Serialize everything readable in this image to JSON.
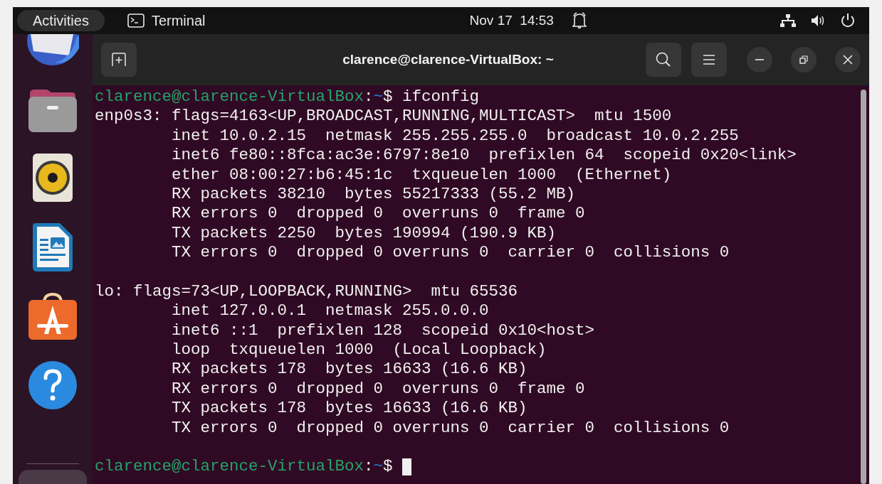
{
  "top_bar": {
    "activities": "Activities",
    "app_name": "Terminal",
    "clock": "Nov 17  14:53"
  },
  "dock": {
    "items": [
      {
        "kind": "mail"
      },
      {
        "kind": "folder"
      },
      {
        "kind": "speaker"
      },
      {
        "kind": "document"
      },
      {
        "kind": "store"
      },
      {
        "kind": "help"
      },
      {
        "kind": "apps"
      }
    ]
  },
  "window": {
    "title": "clarence@clarence-VirtualBox: ~"
  },
  "terminal": {
    "lines": [
      {
        "kind": "prompt",
        "user_host": "clarence@clarence-VirtualBox",
        "separator": ":",
        "path": "~",
        "symbol": "$",
        "command": "ifconfig",
        "cursor": false
      },
      {
        "kind": "output",
        "text": "enp0s3: flags=4163<UP,BROADCAST,RUNNING,MULTICAST>  mtu 1500"
      },
      {
        "kind": "output",
        "text": "        inet 10.0.2.15  netmask 255.255.255.0  broadcast 10.0.2.255"
      },
      {
        "kind": "output",
        "text": "        inet6 fe80::8fca:ac3e:6797:8e10  prefixlen 64  scopeid 0x20<link>"
      },
      {
        "kind": "output",
        "text": "        ether 08:00:27:b6:45:1c  txqueuelen 1000  (Ethernet)"
      },
      {
        "kind": "output",
        "text": "        RX packets 38210  bytes 55217333 (55.2 MB)"
      },
      {
        "kind": "output",
        "text": "        RX errors 0  dropped 0  overruns 0  frame 0"
      },
      {
        "kind": "output",
        "text": "        TX packets 2250  bytes 190994 (190.9 KB)"
      },
      {
        "kind": "output",
        "text": "        TX errors 0  dropped 0 overruns 0  carrier 0  collisions 0"
      },
      {
        "kind": "blank"
      },
      {
        "kind": "output",
        "text": "lo: flags=73<UP,LOOPBACK,RUNNING>  mtu 65536"
      },
      {
        "kind": "output",
        "text": "        inet 127.0.0.1  netmask 255.0.0.0"
      },
      {
        "kind": "output",
        "text": "        inet6 ::1  prefixlen 128  scopeid 0x10<host>"
      },
      {
        "kind": "output",
        "text": "        loop  txqueuelen 1000  (Local Loopback)"
      },
      {
        "kind": "output",
        "text": "        RX packets 178  bytes 16633 (16.6 KB)"
      },
      {
        "kind": "output",
        "text": "        RX errors 0  dropped 0  overruns 0  frame 0"
      },
      {
        "kind": "output",
        "text": "        TX packets 178  bytes 16633 (16.6 KB)"
      },
      {
        "kind": "output",
        "text": "        TX errors 0  dropped 0 overruns 0  carrier 0  collisions 0"
      },
      {
        "kind": "blank"
      },
      {
        "kind": "prompt",
        "user_host": "clarence@clarence-VirtualBox",
        "separator": ":",
        "path": "~",
        "symbol": "$",
        "cursor": true
      }
    ]
  }
}
